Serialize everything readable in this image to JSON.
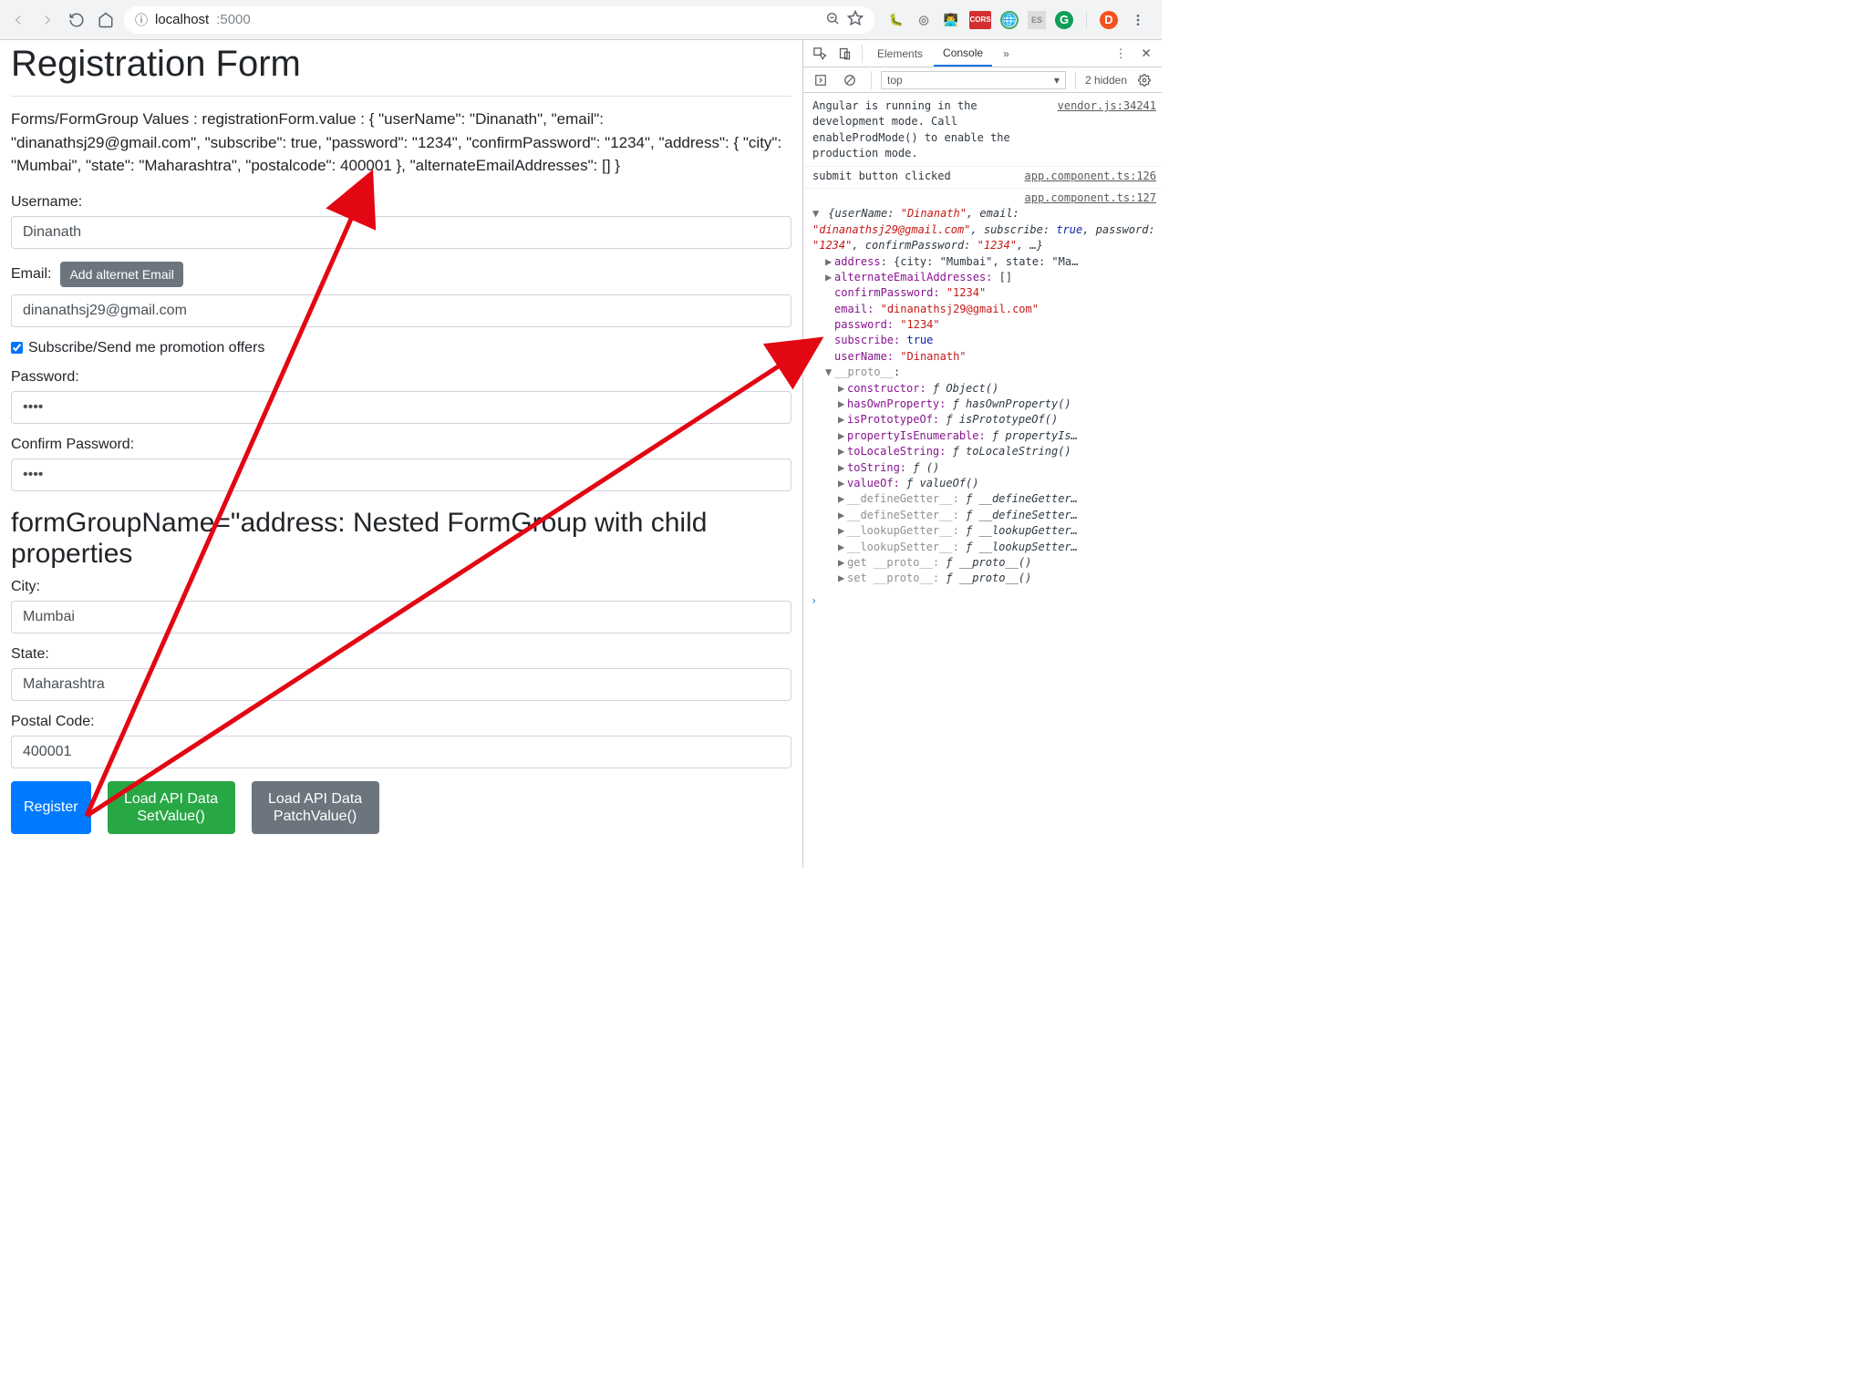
{
  "browser": {
    "url_host": "localhost",
    "url_port": ":5000",
    "info_mark": "ⓘ"
  },
  "page": {
    "title": "Registration Form",
    "dump_label": "Forms/FormGroup Values : registrationForm.value : ",
    "dump_json": "{ \"userName\": \"Dinanath\", \"email\": \"dinanathsj29@gmail.com\", \"subscribe\": true, \"password\": \"1234\", \"confirmPassword\": \"1234\", \"address\": { \"city\": \"Mumbai\", \"state\": \"Maharashtra\", \"postalcode\": 400001 }, \"alternateEmailAddresses\": [] }",
    "labels": {
      "username": "Username:",
      "email": "Email:",
      "add_alt_email": "Add alternet Email",
      "subscribe": "Subscribe/Send me promotion offers",
      "password": "Password:",
      "confirm_password": "Confirm Password:",
      "nested_heading": "formGroupName=\"address: Nested FormGroup with child properties",
      "city": "City:",
      "state": "State:",
      "postal": "Postal Code:"
    },
    "values": {
      "username": "Dinanath",
      "email": "dinanathsj29@gmail.com",
      "password": "••••",
      "confirm_password": "••••",
      "city": "Mumbai",
      "state": "Maharashtra",
      "postal": "400001"
    },
    "buttons": {
      "register": "Register",
      "load_set1": "Load API Data",
      "load_set2": "SetValue()",
      "load_patch1": "Load API Data",
      "load_patch2": "PatchValue()"
    }
  },
  "devtools": {
    "tabs": {
      "elements": "Elements",
      "console": "Console",
      "overflow": "»"
    },
    "context": "top",
    "hidden": "2 hidden",
    "log1": {
      "msg": "Angular is running in the development mode. Call enableProdMode() to enable the production mode.",
      "src": "vendor.js:34241"
    },
    "log2": {
      "msg": "submit button clicked",
      "src": "app.component.ts:126"
    },
    "log3": {
      "src": "app.component.ts:127",
      "summary_pre": "{userName: ",
      "summary_v1": "\"Dinanath\"",
      "summary_mid1": ", email: ",
      "summary_v2": "\"dinanathsj29@gmail.com\"",
      "summary_mid2": ", subscribe: ",
      "summary_v3": "true",
      "summary_mid3": ", password: ",
      "summary_v4": "\"1234\"",
      "summary_mid4": ", confirmPassword: ",
      "summary_v5": "\"1234\"",
      "summary_post": ", …}",
      "props": {
        "address_k": "address:",
        "address_v": "{city: \"Mumbai\", state: \"Ma…",
        "alt_k": "alternateEmailAddresses:",
        "alt_v": "[]",
        "cpw_k": "confirmPassword:",
        "cpw_v": "\"1234\"",
        "email_k": "email:",
        "email_v": "\"dinanathsj29@gmail.com\"",
        "pw_k": "password:",
        "pw_v": "\"1234\"",
        "sub_k": "subscribe:",
        "sub_v": "true",
        "un_k": "userName:",
        "un_v": "\"Dinanath\"",
        "proto_k": "__proto__",
        "proto_colon": ":",
        "ctor_k": "constructor:",
        "ctor_v": "ƒ Object()",
        "hop_k": "hasOwnProperty:",
        "hop_v": "ƒ hasOwnProperty()",
        "ipo_k": "isPrototypeOf:",
        "ipo_v": "ƒ isPrototypeOf()",
        "pie_k": "propertyIsEnumerable:",
        "pie_v": "ƒ propertyIs…",
        "tls_k": "toLocaleString:",
        "tls_v": "ƒ toLocaleString()",
        "ts_k": "toString:",
        "ts_v": "ƒ ()",
        "vo_k": "valueOf:",
        "vo_v": "ƒ valueOf()",
        "dg_k": "__defineGetter__:",
        "dg_v": "ƒ __defineGetter…",
        "ds_k": "__defineSetter__:",
        "ds_v": "ƒ __defineSetter…",
        "lg_k": "__lookupGetter__:",
        "lg_v": "ƒ __lookupGetter…",
        "ls_k": "__lookupSetter__:",
        "ls_v": "ƒ __lookupSetter…",
        "gp_k": "get __proto__:",
        "gp_v": "ƒ __proto__()",
        "sp_k": "set __proto__:",
        "sp_v": "ƒ __proto__()"
      }
    }
  }
}
